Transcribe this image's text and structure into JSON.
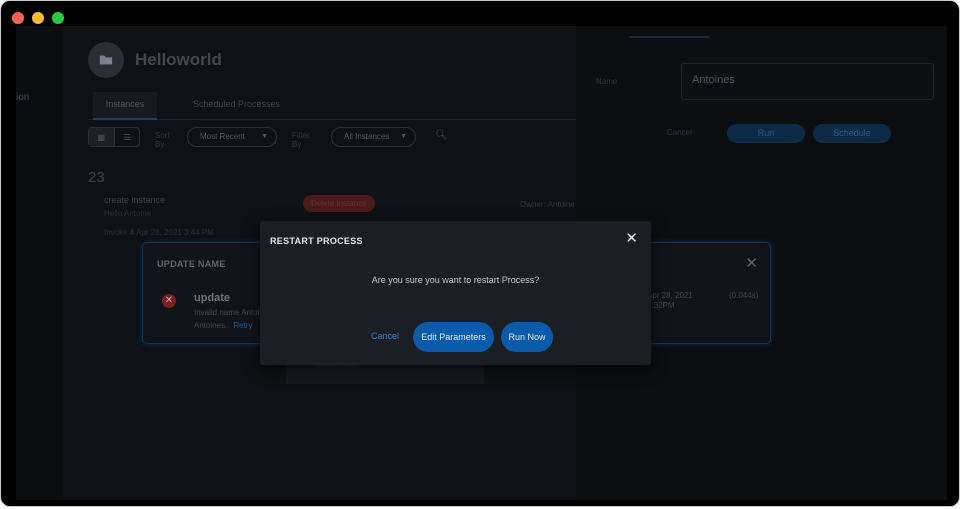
{
  "window": {
    "controls": {
      "close_color": "#fe5f57",
      "minimize_color": "#febc2e",
      "maximize_color": "#28c840"
    }
  },
  "nav": {
    "item_partial_1": "",
    "item_partial_2": "ion"
  },
  "process": {
    "title": "Helloworld",
    "icon": "folder-icon",
    "tabs": [
      {
        "label": "Instances",
        "active": true
      },
      {
        "label": "Scheduled Processes",
        "active": false
      }
    ],
    "toolbar": {
      "sort_label": "Sort By",
      "sort_value": "Most Recent",
      "filter_label": "Filter By",
      "filter_value": "All Instances"
    },
    "instance_count": "23",
    "instance": {
      "name": "create instance",
      "sub": "Hello Antoine",
      "date": "Invoke 4 Apr 28, 2021 3:44 PM",
      "badge": "Delete Instance",
      "owner_label": "Owner:",
      "owner": "Antoine"
    }
  },
  "right_panel": {
    "name_label": "Name",
    "name_value": "Antoines",
    "cancel_label": "Cancel",
    "run_label": "Run",
    "schedule_label": "Schedule"
  },
  "bottom_strip": {
    "text": "Update Name"
  },
  "update_dialog": {
    "title": "UPDATE NAME",
    "item_title": "update",
    "item_desc": "Invalid name Antoi",
    "item_desc2": "Antoines.",
    "retry_label": "Retry",
    "date": "Apr 28, 2021",
    "time": "3:32PM",
    "duration": "(0.044s)"
  },
  "modal": {
    "title": "RESTART PROCESS",
    "message": "Are you sure you want to restart Process?",
    "cancel_label": "Cancel",
    "edit_label": "Edit Parameters",
    "run_now_label": "Run Now",
    "accent_color": "#0a5baa"
  }
}
